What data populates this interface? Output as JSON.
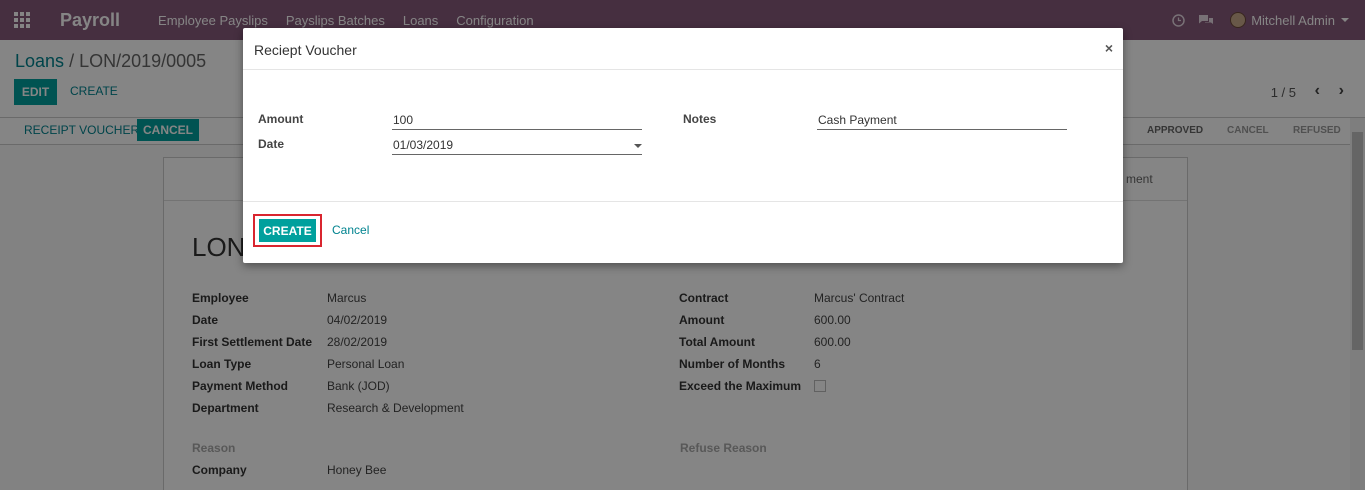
{
  "navbar": {
    "brand": "Payroll",
    "menu": [
      "Employee Payslips",
      "Payslips Batches",
      "Loans",
      "Configuration"
    ],
    "user": "Mitchell Admin",
    "icons": [
      "apps-icon",
      "clock-icon",
      "chat-icon"
    ]
  },
  "control": {
    "breadcrumb_root": "Loans",
    "breadcrumb_sep": "/",
    "breadcrumb_current": "LON/2019/0005",
    "edit_label": "EDIT",
    "create_label": "CREATE",
    "pager": "1 / 5",
    "pager_prev": "‹",
    "pager_next": "›"
  },
  "statusbar": {
    "receipt_voucher_label": "RECEIPT VOUCHER",
    "cancel_label": "CANCEL",
    "stages": [
      "APPROVED",
      "CANCEL",
      "REFUSED"
    ]
  },
  "sheet": {
    "partial_text": "ment",
    "title": "LON",
    "left_fields": [
      {
        "label": "Employee",
        "value": "Marcus"
      },
      {
        "label": "Date",
        "value": "04/02/2019"
      },
      {
        "label": "First Settlement Date",
        "value": "28/02/2019"
      },
      {
        "label": "Loan Type",
        "value": "Personal Loan"
      },
      {
        "label": "Payment Method",
        "value": "Bank (JOD)"
      },
      {
        "label": "Department",
        "value": "Research & Development"
      }
    ],
    "right_fields": [
      {
        "label": "Contract",
        "value": "Marcus' Contract"
      },
      {
        "label": "Amount",
        "value": "600.00"
      },
      {
        "label": "Total Amount",
        "value": "600.00"
      },
      {
        "label": "Number of Months",
        "value": "6"
      },
      {
        "label": "Exceed the Maximum",
        "value": ""
      }
    ],
    "reason_label": "Reason",
    "refuse_reason_label": "Refuse Reason",
    "company_label": "Company",
    "company_value": "Honey Bee"
  },
  "modal": {
    "title": "Reciept Voucher",
    "close": "×",
    "amount_label": "Amount",
    "amount_value": "100",
    "date_label": "Date",
    "date_value": "01/03/2019",
    "notes_label": "Notes",
    "notes_value": "Cash Payment",
    "create_label": "CREATE",
    "cancel_label": "Cancel",
    "highlight_color": "#d9252f"
  },
  "colors": {
    "navbar": "#875a7b",
    "primary": "#00a09d",
    "link": "#00838f"
  }
}
